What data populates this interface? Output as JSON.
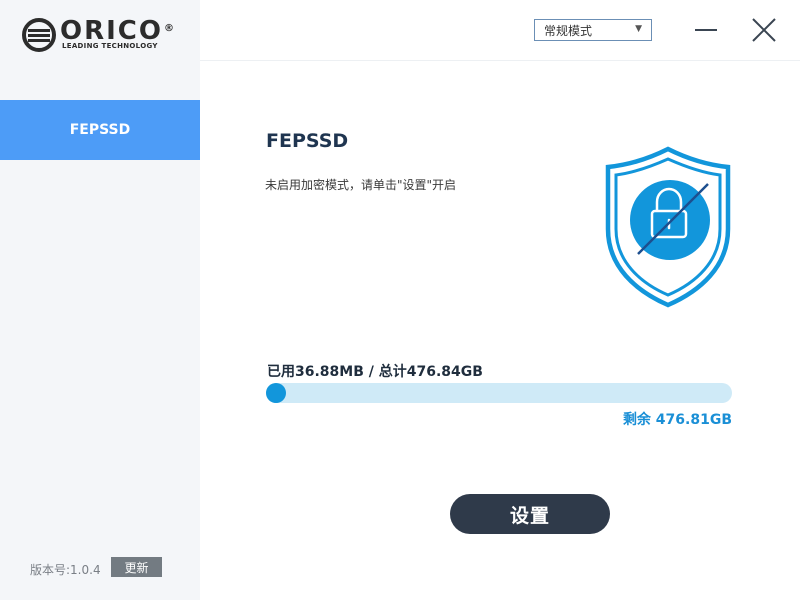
{
  "brand": {
    "name": "ORICO",
    "registered": "®",
    "tagline": "LEADING TECHNOLOGY"
  },
  "sidebar": {
    "items": [
      {
        "label": "FEPSSD",
        "active": true
      }
    ],
    "version_label": "版本号:1.0.4",
    "update_label": "更新"
  },
  "header": {
    "mode_select": {
      "value": "常规模式"
    },
    "minimize_icon": "minimize-icon",
    "close_icon": "close-icon"
  },
  "device": {
    "title": "FEPSSD",
    "description": "未启用加密模式，请单击\"设置\"开启",
    "status_icon": "shield-lock-icon"
  },
  "storage": {
    "usage_text": "已用36.88MB / 总计476.84GB",
    "remaining_text": "剩余 476.81GB",
    "used_fraction": 0.0001
  },
  "actions": {
    "settings_label": "设置"
  },
  "colors": {
    "accent": "#4d9cf7",
    "progress_track": "#cfeaf7",
    "progress_fill": "#1296db",
    "shield": "#1296db",
    "button_dark": "#2f3a4a"
  }
}
